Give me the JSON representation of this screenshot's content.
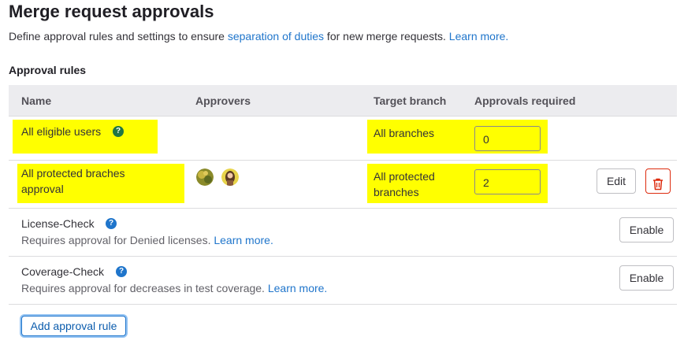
{
  "header": {
    "title": "Merge request approvals",
    "description_prefix": "Define approval rules and settings to ensure ",
    "description_link": "separation of duties",
    "description_suffix": " for new merge requests. ",
    "learn_more": "Learn more."
  },
  "section_label": "Approval rules",
  "table": {
    "columns": [
      "Name",
      "Approvers",
      "Target branch",
      "Approvals required"
    ],
    "rows": [
      {
        "name": "All eligible users",
        "branch": "All branches",
        "approvals": "0"
      },
      {
        "name_line1": "All protected braches",
        "name_line2": "approval",
        "branch_line1": "All protected",
        "branch_line2": "branches",
        "approvals": "2",
        "edit_label": "Edit"
      }
    ]
  },
  "license_check": {
    "name": "License-Check",
    "description": "Requires approval for Denied licenses. ",
    "learn_more": "Learn more.",
    "button": "Enable"
  },
  "coverage_check": {
    "name": "Coverage-Check",
    "description": "Requires approval for decreases in test coverage. ",
    "learn_more": "Learn more.",
    "button": "Enable"
  },
  "add_rule_button": "Add approval rule",
  "icons": {
    "help": "question-circle-icon",
    "delete": "trash-icon"
  },
  "colors": {
    "highlight": "#ffff00",
    "link": "#1f75cb",
    "danger": "#dd2b0e",
    "help_green": "#217645"
  },
  "glyphs": {
    "help": "?"
  }
}
